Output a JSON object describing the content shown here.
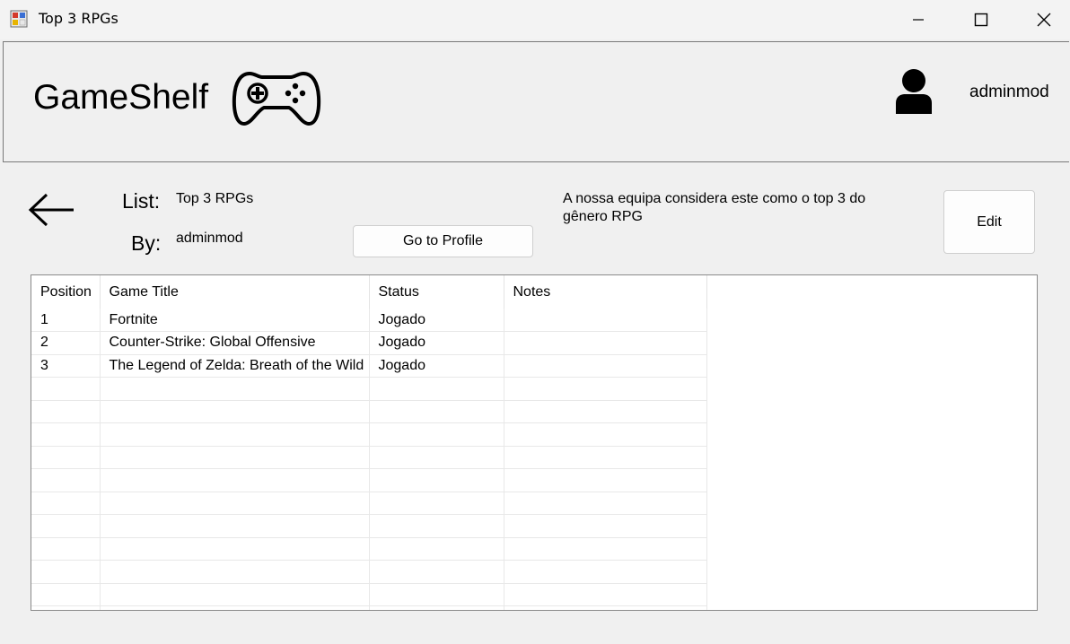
{
  "window": {
    "title": "Top 3 RPGs",
    "minimize_icon": "minimize-icon",
    "maximize_icon": "maximize-icon",
    "close_icon": "close-icon"
  },
  "header": {
    "brand": "GameShelf",
    "brand_icon": "gamepad-icon",
    "user_icon": "user-icon",
    "username": "adminmod"
  },
  "list_info": {
    "back_icon": "arrow-left-icon",
    "list_label": "List:",
    "list_name": "Top 3 RPGs",
    "by_label": "By:",
    "author": "adminmod",
    "go_to_profile": "Go to Profile",
    "description": "A nossa equipa considera este como o top 3 do gênero RPG",
    "edit": "Edit"
  },
  "table": {
    "columns": [
      "Position",
      "Game Title",
      "Status",
      "Notes"
    ],
    "rows": [
      {
        "position": "1",
        "title": "Fortnite",
        "status": "Jogado",
        "notes": ""
      },
      {
        "position": "2",
        "title": "Counter-Strike: Global Offensive",
        "status": "Jogado",
        "notes": ""
      },
      {
        "position": "3",
        "title": "The Legend of Zelda: Breath of the Wild",
        "status": "Jogado",
        "notes": ""
      }
    ]
  }
}
